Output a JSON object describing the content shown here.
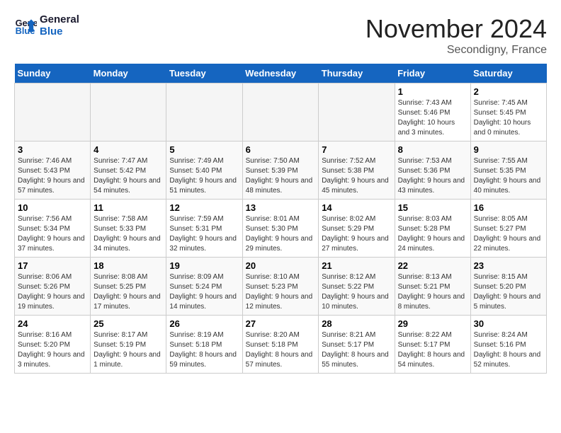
{
  "header": {
    "logo_line1": "General",
    "logo_line2": "Blue",
    "month_title": "November 2024",
    "location": "Secondigny, France"
  },
  "days_of_week": [
    "Sunday",
    "Monday",
    "Tuesday",
    "Wednesday",
    "Thursday",
    "Friday",
    "Saturday"
  ],
  "weeks": [
    [
      {
        "day": "",
        "sunrise": "",
        "sunset": "",
        "daylight": ""
      },
      {
        "day": "",
        "sunrise": "",
        "sunset": "",
        "daylight": ""
      },
      {
        "day": "",
        "sunrise": "",
        "sunset": "",
        "daylight": ""
      },
      {
        "day": "",
        "sunrise": "",
        "sunset": "",
        "daylight": ""
      },
      {
        "day": "",
        "sunrise": "",
        "sunset": "",
        "daylight": ""
      },
      {
        "day": "1",
        "sunrise": "Sunrise: 7:43 AM",
        "sunset": "Sunset: 5:46 PM",
        "daylight": "Daylight: 10 hours and 3 minutes."
      },
      {
        "day": "2",
        "sunrise": "Sunrise: 7:45 AM",
        "sunset": "Sunset: 5:45 PM",
        "daylight": "Daylight: 10 hours and 0 minutes."
      }
    ],
    [
      {
        "day": "3",
        "sunrise": "Sunrise: 7:46 AM",
        "sunset": "Sunset: 5:43 PM",
        "daylight": "Daylight: 9 hours and 57 minutes."
      },
      {
        "day": "4",
        "sunrise": "Sunrise: 7:47 AM",
        "sunset": "Sunset: 5:42 PM",
        "daylight": "Daylight: 9 hours and 54 minutes."
      },
      {
        "day": "5",
        "sunrise": "Sunrise: 7:49 AM",
        "sunset": "Sunset: 5:40 PM",
        "daylight": "Daylight: 9 hours and 51 minutes."
      },
      {
        "day": "6",
        "sunrise": "Sunrise: 7:50 AM",
        "sunset": "Sunset: 5:39 PM",
        "daylight": "Daylight: 9 hours and 48 minutes."
      },
      {
        "day": "7",
        "sunrise": "Sunrise: 7:52 AM",
        "sunset": "Sunset: 5:38 PM",
        "daylight": "Daylight: 9 hours and 45 minutes."
      },
      {
        "day": "8",
        "sunrise": "Sunrise: 7:53 AM",
        "sunset": "Sunset: 5:36 PM",
        "daylight": "Daylight: 9 hours and 43 minutes."
      },
      {
        "day": "9",
        "sunrise": "Sunrise: 7:55 AM",
        "sunset": "Sunset: 5:35 PM",
        "daylight": "Daylight: 9 hours and 40 minutes."
      }
    ],
    [
      {
        "day": "10",
        "sunrise": "Sunrise: 7:56 AM",
        "sunset": "Sunset: 5:34 PM",
        "daylight": "Daylight: 9 hours and 37 minutes."
      },
      {
        "day": "11",
        "sunrise": "Sunrise: 7:58 AM",
        "sunset": "Sunset: 5:33 PM",
        "daylight": "Daylight: 9 hours and 34 minutes."
      },
      {
        "day": "12",
        "sunrise": "Sunrise: 7:59 AM",
        "sunset": "Sunset: 5:31 PM",
        "daylight": "Daylight: 9 hours and 32 minutes."
      },
      {
        "day": "13",
        "sunrise": "Sunrise: 8:01 AM",
        "sunset": "Sunset: 5:30 PM",
        "daylight": "Daylight: 9 hours and 29 minutes."
      },
      {
        "day": "14",
        "sunrise": "Sunrise: 8:02 AM",
        "sunset": "Sunset: 5:29 PM",
        "daylight": "Daylight: 9 hours and 27 minutes."
      },
      {
        "day": "15",
        "sunrise": "Sunrise: 8:03 AM",
        "sunset": "Sunset: 5:28 PM",
        "daylight": "Daylight: 9 hours and 24 minutes."
      },
      {
        "day": "16",
        "sunrise": "Sunrise: 8:05 AM",
        "sunset": "Sunset: 5:27 PM",
        "daylight": "Daylight: 9 hours and 22 minutes."
      }
    ],
    [
      {
        "day": "17",
        "sunrise": "Sunrise: 8:06 AM",
        "sunset": "Sunset: 5:26 PM",
        "daylight": "Daylight: 9 hours and 19 minutes."
      },
      {
        "day": "18",
        "sunrise": "Sunrise: 8:08 AM",
        "sunset": "Sunset: 5:25 PM",
        "daylight": "Daylight: 9 hours and 17 minutes."
      },
      {
        "day": "19",
        "sunrise": "Sunrise: 8:09 AM",
        "sunset": "Sunset: 5:24 PM",
        "daylight": "Daylight: 9 hours and 14 minutes."
      },
      {
        "day": "20",
        "sunrise": "Sunrise: 8:10 AM",
        "sunset": "Sunset: 5:23 PM",
        "daylight": "Daylight: 9 hours and 12 minutes."
      },
      {
        "day": "21",
        "sunrise": "Sunrise: 8:12 AM",
        "sunset": "Sunset: 5:22 PM",
        "daylight": "Daylight: 9 hours and 10 minutes."
      },
      {
        "day": "22",
        "sunrise": "Sunrise: 8:13 AM",
        "sunset": "Sunset: 5:21 PM",
        "daylight": "Daylight: 9 hours and 8 minutes."
      },
      {
        "day": "23",
        "sunrise": "Sunrise: 8:15 AM",
        "sunset": "Sunset: 5:20 PM",
        "daylight": "Daylight: 9 hours and 5 minutes."
      }
    ],
    [
      {
        "day": "24",
        "sunrise": "Sunrise: 8:16 AM",
        "sunset": "Sunset: 5:20 PM",
        "daylight": "Daylight: 9 hours and 3 minutes."
      },
      {
        "day": "25",
        "sunrise": "Sunrise: 8:17 AM",
        "sunset": "Sunset: 5:19 PM",
        "daylight": "Daylight: 9 hours and 1 minute."
      },
      {
        "day": "26",
        "sunrise": "Sunrise: 8:19 AM",
        "sunset": "Sunset: 5:18 PM",
        "daylight": "Daylight: 8 hours and 59 minutes."
      },
      {
        "day": "27",
        "sunrise": "Sunrise: 8:20 AM",
        "sunset": "Sunset: 5:18 PM",
        "daylight": "Daylight: 8 hours and 57 minutes."
      },
      {
        "day": "28",
        "sunrise": "Sunrise: 8:21 AM",
        "sunset": "Sunset: 5:17 PM",
        "daylight": "Daylight: 8 hours and 55 minutes."
      },
      {
        "day": "29",
        "sunrise": "Sunrise: 8:22 AM",
        "sunset": "Sunset: 5:17 PM",
        "daylight": "Daylight: 8 hours and 54 minutes."
      },
      {
        "day": "30",
        "sunrise": "Sunrise: 8:24 AM",
        "sunset": "Sunset: 5:16 PM",
        "daylight": "Daylight: 8 hours and 52 minutes."
      }
    ]
  ]
}
